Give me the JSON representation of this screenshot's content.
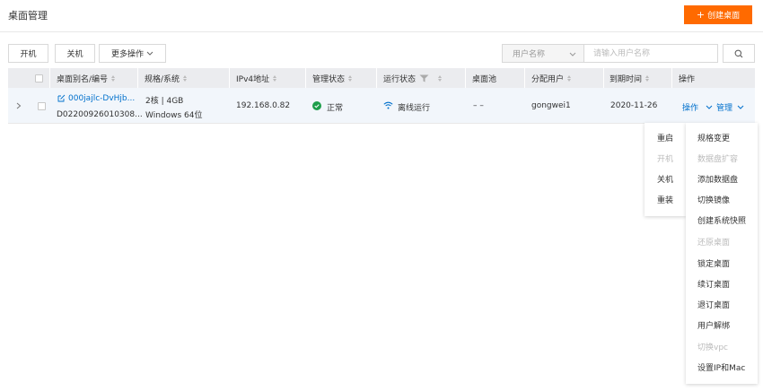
{
  "header": {
    "title": "桌面管理",
    "create_label": "创建桌面"
  },
  "toolbar": {
    "power_on": "开机",
    "power_off": "关机",
    "more_actions": "更多操作"
  },
  "search": {
    "field_label": "用户名称",
    "placeholder": "请输入用户名称"
  },
  "table": {
    "columns": [
      "桌面别名/编号",
      "规格/系统",
      "IPv4地址",
      "管理状态",
      "运行状态",
      "桌面池",
      "分配用户",
      "到期时间",
      "操作"
    ],
    "rows": [
      {
        "alias": "000jajlc-DvHjb...",
        "id": "D02200926010308...",
        "spec": "2核 | 4GB",
        "os": "Windows 64位",
        "ipv4": "192.168.0.82",
        "mgmt_status": "正常",
        "run_status": "离线运行",
        "pool": "– –",
        "user": "gongwei1",
        "expiry": "2020-11-26",
        "action_label": "操作",
        "manage_label": "管理"
      }
    ]
  },
  "action_menu": [
    {
      "label": "重启",
      "disabled": false
    },
    {
      "label": "开机",
      "disabled": true
    },
    {
      "label": "关机",
      "disabled": false
    },
    {
      "label": "重装",
      "disabled": false
    }
  ],
  "manage_menu": [
    {
      "label": "规格变更",
      "disabled": false
    },
    {
      "label": "数据盘扩容",
      "disabled": true
    },
    {
      "label": "添加数据盘",
      "disabled": false
    },
    {
      "label": "切换镜像",
      "disabled": false
    },
    {
      "label": "创建系统快照",
      "disabled": false
    },
    {
      "label": "还原桌面",
      "disabled": true
    },
    {
      "label": "锁定桌面",
      "disabled": false
    },
    {
      "label": "续订桌面",
      "disabled": false
    },
    {
      "label": "退订桌面",
      "disabled": false
    },
    {
      "label": "用户解绑",
      "disabled": false
    },
    {
      "label": "切换vpc",
      "disabled": true
    },
    {
      "label": "设置IP和Mac",
      "disabled": false
    }
  ],
  "colors": {
    "accent": "#ff6a00",
    "link": "#0070cc",
    "success": "#1e9e4a",
    "header_bg": "#ebecef",
    "row_bg": "#f2f6fb"
  },
  "icons": [
    "plus-icon",
    "chevron-down-icon",
    "search-icon",
    "sort-icon",
    "filter-icon",
    "chevron-right-icon",
    "edit-icon",
    "check-circle-icon",
    "wifi-icon"
  ]
}
